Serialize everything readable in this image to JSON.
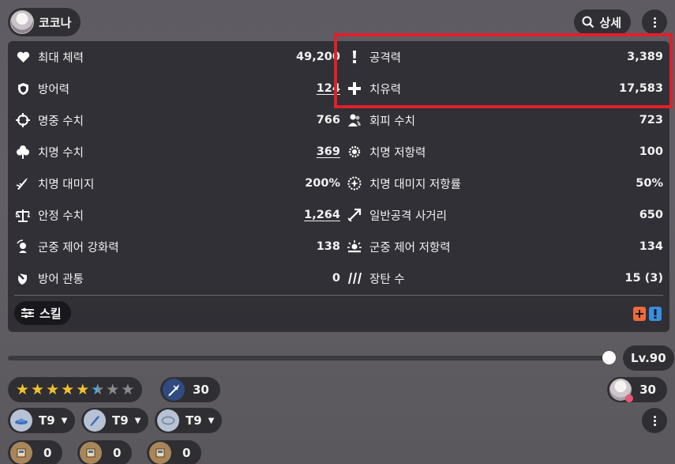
{
  "header": {
    "character_name": "코코나",
    "detail_label": "상세"
  },
  "stats_left": [
    {
      "label": "최대 체력",
      "value": "49,200",
      "icon": "heart-icon",
      "underline": false
    },
    {
      "label": "방어력",
      "value": "124",
      "icon": "shield-icon",
      "underline": true
    },
    {
      "label": "명중 수치",
      "value": "766",
      "icon": "crosshair-icon",
      "underline": false
    },
    {
      "label": "치명 수치",
      "value": "369",
      "icon": "clover-icon",
      "underline": true
    },
    {
      "label": "치명 대미지",
      "value": "200%",
      "icon": "crit-damage-icon",
      "underline": false
    },
    {
      "label": "안정 수치",
      "value": "1,264",
      "icon": "scale-icon",
      "underline": true
    },
    {
      "label": "군중 제어 강화력",
      "value": "138",
      "icon": "cc-power-icon",
      "underline": false
    },
    {
      "label": "방어 관통",
      "value": "0",
      "icon": "armor-pierce-icon",
      "underline": false
    }
  ],
  "stats_right": [
    {
      "label": "공격력",
      "value": "3,389",
      "icon": "attack-icon"
    },
    {
      "label": "치유력",
      "value": "17,583",
      "icon": "heal-icon"
    },
    {
      "label": "회피 수치",
      "value": "723",
      "icon": "evasion-icon"
    },
    {
      "label": "치명 저항력",
      "value": "100",
      "icon": "crit-resist-icon"
    },
    {
      "label": "치명 대미지 저항률",
      "value": "50%",
      "icon": "crit-damage-resist-icon"
    },
    {
      "label": "일반공격 사거리",
      "value": "650",
      "icon": "range-icon"
    },
    {
      "label": "군중 제어 저항력",
      "value": "134",
      "icon": "cc-resist-icon"
    },
    {
      "label": "장탄 수",
      "value": "15 (3)",
      "icon": "ammo-icon"
    }
  ],
  "skill_label": "스킬",
  "level": {
    "label": "Lv.90",
    "fraction": 1.0
  },
  "stars": {
    "filled": 5,
    "half_blue": 1,
    "total": 8,
    "color_gold": "#f2c12e",
    "color_blue": "#3fb0f0"
  },
  "weapon_level": "30",
  "affection_level": "30",
  "tiers": [
    {
      "label": "T9",
      "icon": "hat-gear-icon"
    },
    {
      "label": "T9",
      "icon": "gloves-gear-icon"
    },
    {
      "label": "T9",
      "icon": "necklace-gear-icon"
    }
  ],
  "counts": [
    {
      "value": "0",
      "icon": "book-icon"
    },
    {
      "value": "0",
      "icon": "book-icon"
    },
    {
      "value": "0",
      "icon": "book-icon"
    }
  ],
  "colors": {
    "highlight": "#e0202a",
    "accent_orange": "#f26a3a",
    "accent_blue": "#3b8de0"
  }
}
